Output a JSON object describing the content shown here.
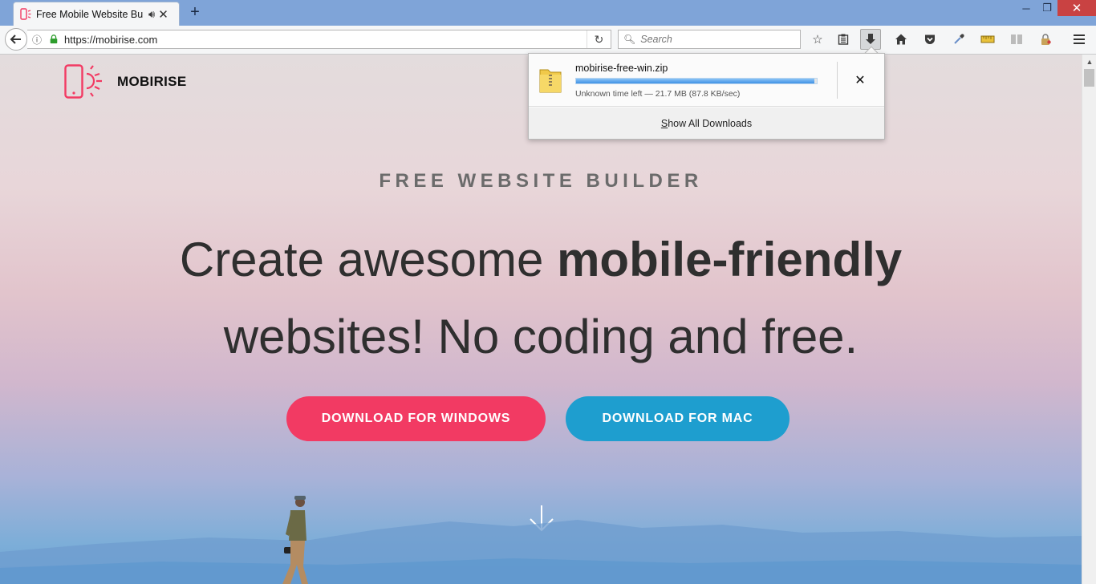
{
  "browser": {
    "tab": {
      "title": "Free Mobile Website Bu",
      "audio_icon": "speaker-icon",
      "close_glyph": "✕"
    },
    "new_tab_glyph": "+",
    "window_controls": {
      "minimize": "─",
      "restore": "❐",
      "close": "✕"
    },
    "nav": {
      "url": "https://mobirise.com",
      "search_placeholder": "Search"
    }
  },
  "downloads_panel": {
    "file_name": "mobirise-free-win.zip",
    "progress_fraction": 0.99,
    "status": "Unknown time left — 21.7 MB (87.8 KB/sec)",
    "cancel_glyph": "✕",
    "show_all_label": "Show All Downloads"
  },
  "page": {
    "brand": {
      "name": "MOBIRISE",
      "accent": "#f23a63"
    },
    "kicker": "FREE WEBSITE BUILDER",
    "headline": {
      "part1": "Create awesome ",
      "bold": "mobile-friendly",
      "line2": "websites! No coding and free."
    },
    "buttons": {
      "windows": {
        "label": "DOWNLOAD FOR WINDOWS",
        "color": "#f23a63"
      },
      "mac": {
        "label": "DOWNLOAD FOR MAC",
        "color": "#1e9ecf"
      }
    }
  }
}
